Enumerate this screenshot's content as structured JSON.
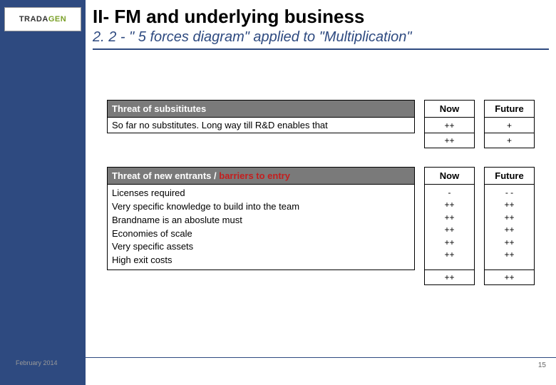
{
  "logo": {
    "brand_left": "TRADA",
    "brand_right": "GEN"
  },
  "header": {
    "title": "II-   FM and underlying business",
    "subtitle": "2. 2 - \" 5 forces diagram\" applied to \"Multiplication\""
  },
  "cols": {
    "now": "Now",
    "future": "Future"
  },
  "table1": {
    "heading": "Threat of subsititutes",
    "rows": [
      {
        "desc": "So far no substitutes. Long way till R&D enables that",
        "now": "++",
        "future": "+"
      }
    ],
    "summary": {
      "now": "++",
      "future": "+"
    }
  },
  "table2": {
    "heading_a": "Threat of new entrants / ",
    "heading_b": "barriers to entry",
    "rows": [
      {
        "desc": "Licenses required",
        "now": "-",
        "future": "- -"
      },
      {
        "desc": "Very specific knowledge to build into the team",
        "now": "++",
        "future": "++"
      },
      {
        "desc": "Brandname is an aboslute must",
        "now": "++",
        "future": "++"
      },
      {
        "desc": "Economies of scale",
        "now": "++",
        "future": "++"
      },
      {
        "desc": "Very specific assets",
        "now": "++",
        "future": "++"
      },
      {
        "desc": "High exit costs",
        "now": "++",
        "future": "++"
      }
    ],
    "summary": {
      "now": "++",
      "future": "++"
    }
  },
  "footer": {
    "date": "February 2014",
    "page": "15"
  }
}
